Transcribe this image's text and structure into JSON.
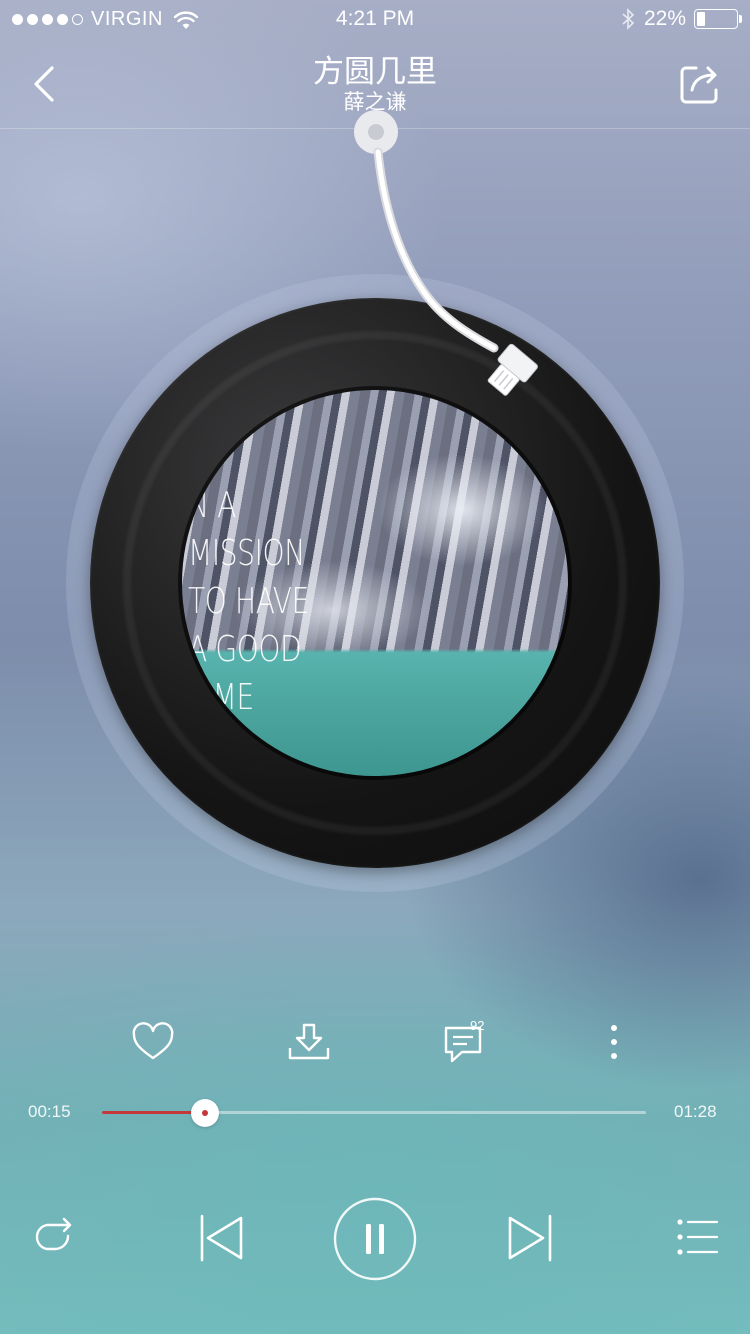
{
  "status_bar": {
    "carrier": "VIRGIN",
    "time": "4:21 PM",
    "battery": "22%",
    "battery_level": 0.22,
    "signal_dots_filled": 4,
    "signal_dots_total": 5,
    "icons": [
      "wifi-icon",
      "bluetooth-icon",
      "battery-icon"
    ]
  },
  "header": {
    "title": "方圆几里",
    "artist": "薛之谦",
    "icons": [
      "back-icon",
      "share-icon"
    ]
  },
  "album": {
    "cover_text": [
      "N A",
      "MISSION",
      "TO HAVE",
      "A GOOD",
      "TIME"
    ]
  },
  "actions": {
    "icons": [
      "heart-icon",
      "download-icon",
      "comment-icon",
      "more-icon"
    ],
    "comment_count": "92"
  },
  "progress": {
    "elapsed": "00:15",
    "duration": "01:28",
    "played_fraction": 0.19
  },
  "controls": {
    "icons": [
      "repeat-icon",
      "previous-icon",
      "pause-icon",
      "next-icon",
      "playlist-icon"
    ]
  },
  "colors": {
    "accent": "#c4383a",
    "text": "#ffffff"
  }
}
